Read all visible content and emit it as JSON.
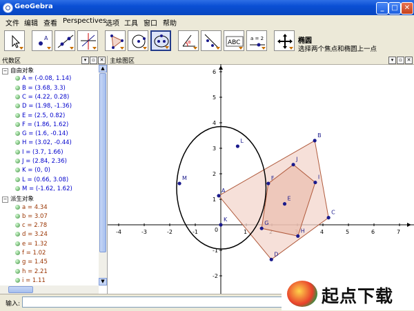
{
  "window": {
    "title": "GeoGebra",
    "buttons": {
      "minimize": "_",
      "maximize": "□",
      "close": "✕"
    }
  },
  "menu": [
    "文件",
    "编辑",
    "查看",
    "Perspectives",
    "选项",
    "工具",
    "窗口",
    "帮助"
  ],
  "toolbar": {
    "tools": [
      "move-tool",
      "point-tool",
      "line-tool",
      "perpendicular-tool",
      "polygon-tool",
      "circle-tool",
      "ellipse-tool",
      "angle-tool",
      "reflect-tool",
      "text-tool",
      "slider-tool",
      "move-view-tool"
    ],
    "selected_tool": "ellipse-tool",
    "text_tool_label": "ABC",
    "slider_tool_label": "a = 2",
    "help_title": "椭圆",
    "help_desc": "选择两个焦点和椭圆上一点"
  },
  "algebra": {
    "title": "代数区",
    "free_header": "自由对象",
    "free": [
      "A = (-0.08, 1.14)",
      "B = (3.68, 3.3)",
      "C = (4.22, 0.28)",
      "D = (1.98, -1.36)",
      "E = (2.5, 0.82)",
      "F = (1.86, 1.62)",
      "G = (1.6, -0.14)",
      "H = (3.02, -0.44)",
      "I = (3.7, 1.66)",
      "J = (2.84, 2.36)",
      "K = (0, 0)",
      "L = (0.66, 3.08)",
      "M = (-1.62, 1.62)"
    ],
    "dep_header": "派生对象",
    "dependent": [
      "a = 4.34",
      "b = 3.07",
      "c = 2.78",
      "d = 3.24",
      "e = 1.32",
      "f = 1.02",
      "g = 1.45",
      "h = 2.21",
      "i = 1.11"
    ]
  },
  "graphics": {
    "title": "主绘图区",
    "x_ticks": [
      "-4",
      "-3",
      "-2",
      "-1",
      "1",
      "2",
      "3",
      "4",
      "5",
      "6",
      "7"
    ],
    "y_ticks": [
      "6",
      "5",
      "4",
      "3",
      "2",
      "1",
      "-1",
      "-2"
    ],
    "origin_label": "0",
    "points": [
      {
        "name": "A",
        "x": -0.08,
        "y": 1.14
      },
      {
        "name": "B",
        "x": 3.68,
        "y": 3.3
      },
      {
        "name": "C",
        "x": 4.22,
        "y": 0.28
      },
      {
        "name": "D",
        "x": 1.98,
        "y": -1.36
      },
      {
        "name": "E",
        "x": 2.5,
        "y": 0.82
      },
      {
        "name": "F",
        "x": 1.86,
        "y": 1.62
      },
      {
        "name": "G",
        "x": 1.6,
        "y": -0.14
      },
      {
        "name": "H",
        "x": 3.02,
        "y": -0.44
      },
      {
        "name": "I",
        "x": 3.7,
        "y": 1.66
      },
      {
        "name": "J",
        "x": 2.84,
        "y": 2.36
      },
      {
        "name": "K",
        "x": 0,
        "y": 0
      },
      {
        "name": "L",
        "x": 0.66,
        "y": 3.08
      },
      {
        "name": "M",
        "x": -1.62,
        "y": 1.62
      }
    ],
    "polygon_outer": [
      "A",
      "B",
      "C",
      "D"
    ],
    "polygon_inner": [
      "F",
      "J",
      "I",
      "H",
      "G"
    ],
    "ellipse": {
      "center_x": 0.02,
      "center_y": 1.45,
      "rx": 1.75,
      "ry": 2.4
    },
    "colors": {
      "point": "#1a1a8c",
      "polygon_fill": "#f3d6cc",
      "polygon_stroke": "#b05a3c",
      "ellipse": "#000000",
      "axis": "#000000"
    }
  },
  "input": {
    "label": "输入:",
    "value": ""
  },
  "watermark": {
    "text": "起点下载"
  }
}
